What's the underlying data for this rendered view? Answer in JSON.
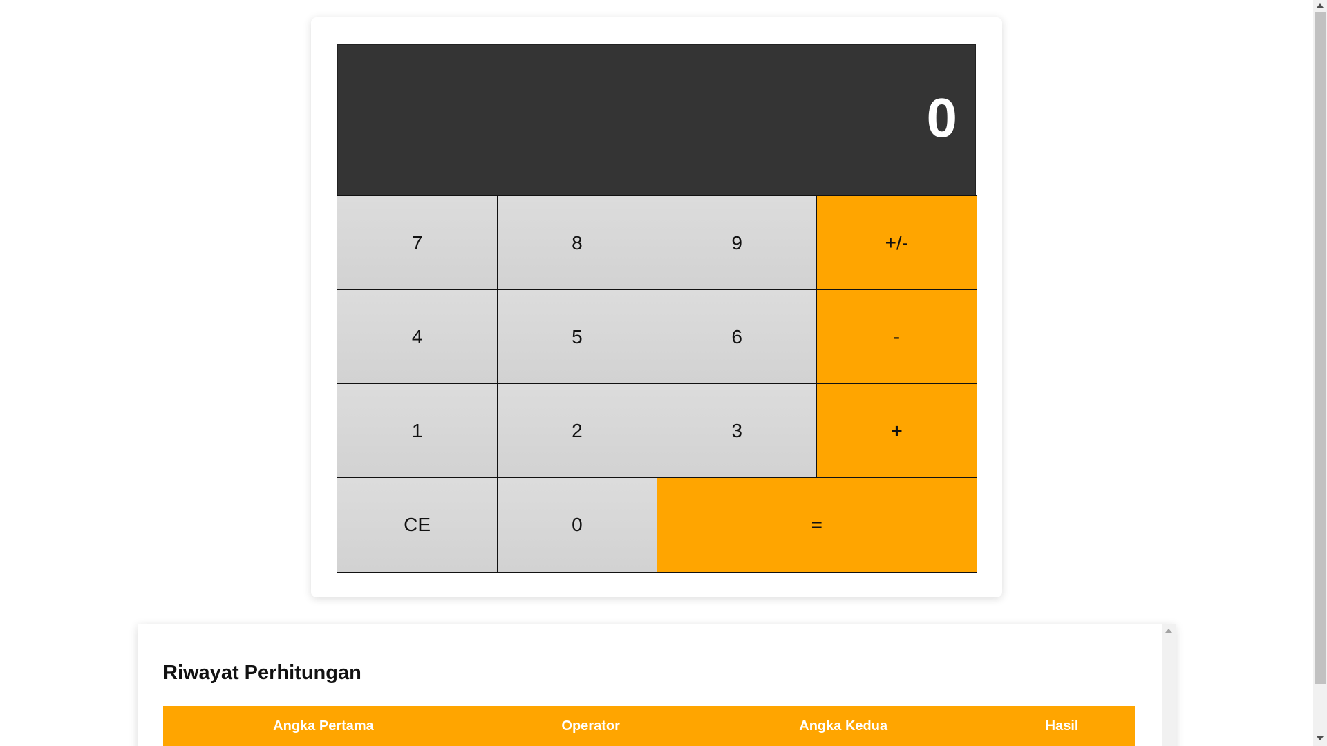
{
  "calculator": {
    "display_value": "0",
    "keys": {
      "seven": "7",
      "eight": "8",
      "nine": "9",
      "negate": "+/-",
      "four": "4",
      "five": "5",
      "six": "6",
      "minus": "-",
      "one": "1",
      "two": "2",
      "three": "3",
      "plus": "+",
      "clear_entry": "CE",
      "zero": "0",
      "equals": "="
    },
    "colors": {
      "display_bg": "#343434",
      "number_key_bg": "#d6d6d6",
      "operator_key_bg": "#ffa500"
    }
  },
  "history": {
    "title": "Riwayat Perhitungan",
    "columns": [
      "Angka Pertama",
      "Operator",
      "Angka Kedua",
      "Hasil"
    ],
    "rows": [],
    "header_color": "#ffa500"
  },
  "icons": {
    "scroll_up": "chevron-up-icon",
    "scroll_down": "chevron-down-icon"
  }
}
